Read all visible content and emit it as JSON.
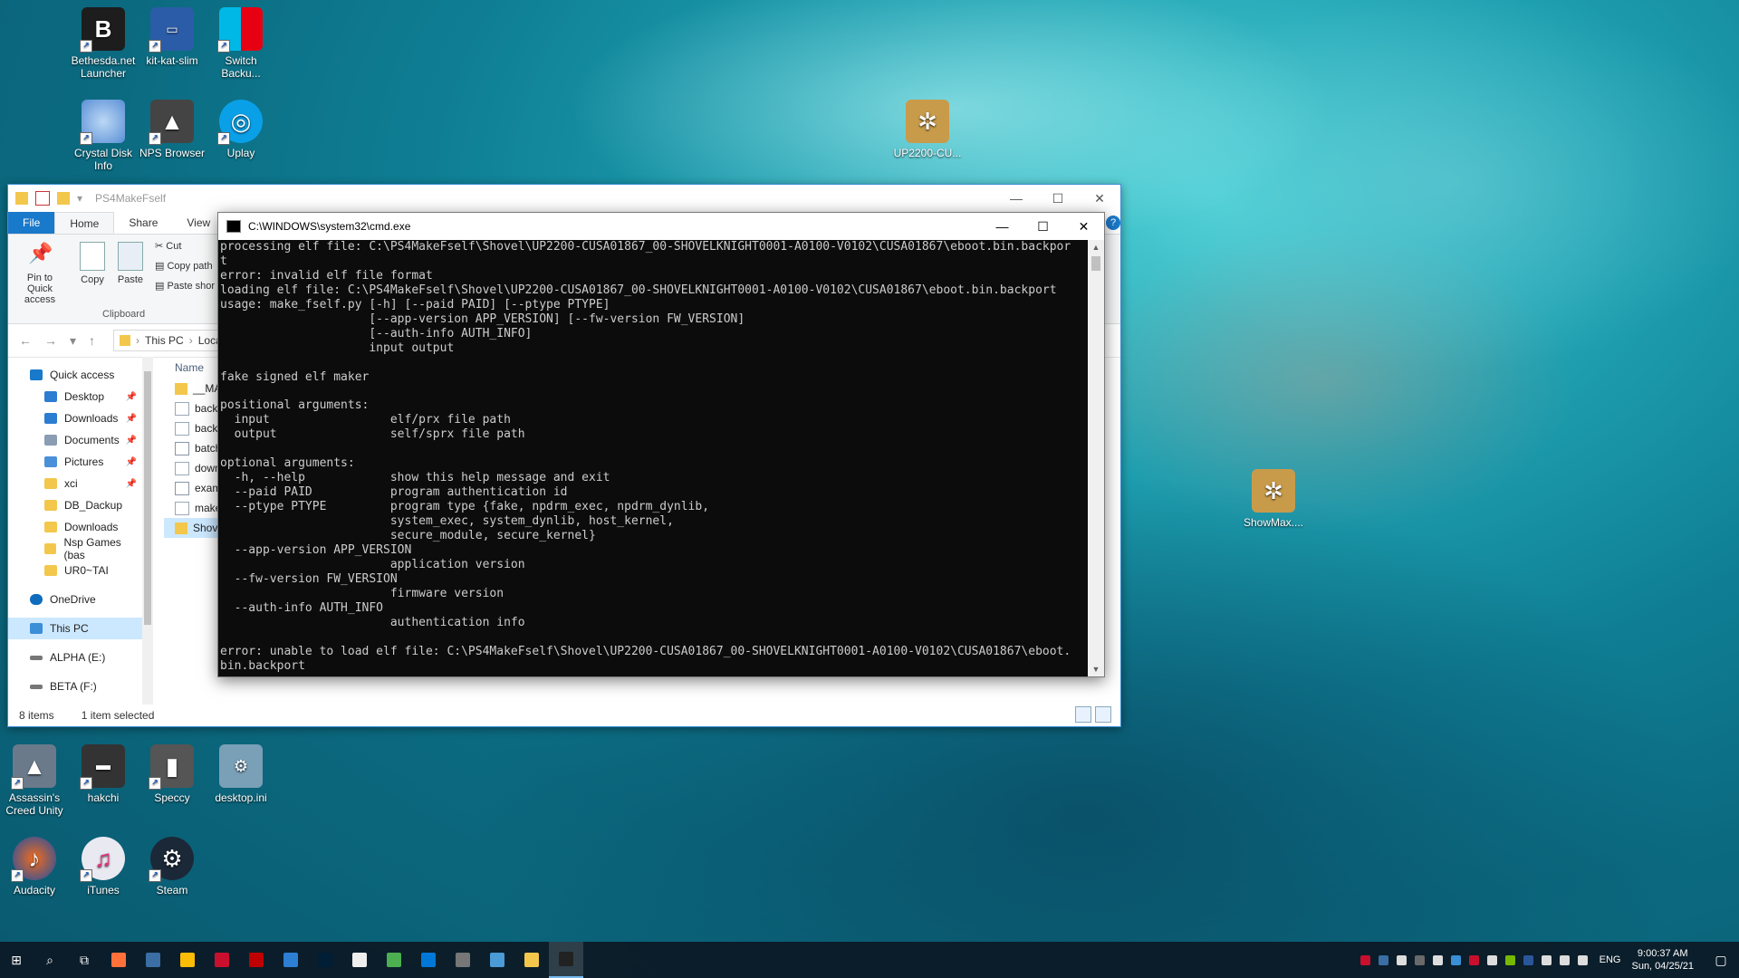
{
  "desktop": {
    "icons": [
      {
        "label": "Bethesda.net Launcher",
        "icon": "bethesda-icon",
        "color": "#1d1d1d"
      },
      {
        "label": "kit-kat-slim",
        "icon": "kit-kat-slim-icon",
        "color": "#2b5ca8"
      },
      {
        "label": "Switch Backu...",
        "icon": "switch-icon",
        "color": "#e60012"
      },
      {
        "label": "Crystal Disk Info",
        "icon": "crystal-disk-icon",
        "color": "#5a8fd6"
      },
      {
        "label": "NPS Browser",
        "icon": "nps-browser-icon",
        "color": "#444444"
      },
      {
        "label": "Uplay",
        "icon": "uplay-icon",
        "color": "#0aa0e8"
      },
      {
        "label": "UP2200-CU...",
        "icon": "package-icon",
        "color": "#c89b4a"
      },
      {
        "label": "ShowMax....",
        "icon": "package-icon",
        "color": "#c89b4a"
      },
      {
        "label": "Assassin's Creed Unity",
        "icon": "assassins-creed-icon",
        "color": "#6a7a8a"
      },
      {
        "label": "hakchi",
        "icon": "hakchi-icon",
        "color": "#333333"
      },
      {
        "label": "Speccy",
        "icon": "speccy-icon",
        "color": "#555555"
      },
      {
        "label": "desktop.ini",
        "icon": "ini-file-icon",
        "color": "#7aa0b8"
      },
      {
        "label": "Audacity",
        "icon": "audacity-icon",
        "color": "#f26b1d"
      },
      {
        "label": "iTunes",
        "icon": "itunes-icon",
        "color": "#e9e9f2"
      },
      {
        "label": "Steam",
        "icon": "steam-icon",
        "color": "#1b2838"
      }
    ]
  },
  "explorer": {
    "title": "PS4MakeFself",
    "tabs": [
      "File",
      "Home",
      "Share",
      "View"
    ],
    "ribbon": {
      "pin_label": "Pin to Quick access",
      "copy_label": "Copy",
      "paste_label": "Paste",
      "cut_label": "Cut",
      "copy_path_label": "Copy path",
      "paste_shortcut_label": "Paste shor",
      "group_label": "Clipboard"
    },
    "address": {
      "crumb1": "This PC",
      "crumb2": "Loca"
    },
    "nav_items": [
      {
        "label": "Quick access",
        "color": "#1979ca",
        "pinned": false
      },
      {
        "label": "Desktop",
        "color": "#2c7cd1",
        "pinned": true
      },
      {
        "label": "Downloads",
        "color": "#2c7cd1",
        "pinned": true
      },
      {
        "label": "Documents",
        "color": "#8a9db3",
        "pinned": true
      },
      {
        "label": "Pictures",
        "color": "#4a90d9",
        "pinned": true
      },
      {
        "label": "xci",
        "color": "#f3c74c",
        "pinned": true
      },
      {
        "label": "DB_Dackup",
        "color": "#f3c74c",
        "pinned": false
      },
      {
        "label": "Downloads",
        "color": "#f3c74c",
        "pinned": false
      },
      {
        "label": "Nsp Games (bas",
        "color": "#f3c74c",
        "pinned": false
      },
      {
        "label": "UR0~TAI",
        "color": "#f3c74c",
        "pinned": false
      },
      {
        "label": "OneDrive",
        "color": "#0f6cbd",
        "pinned": false
      },
      {
        "label": "This PC",
        "color": "#3a8fd6",
        "pinned": false
      },
      {
        "label": "ALPHA (E:)",
        "color": "#777777",
        "pinned": false
      },
      {
        "label": "BETA (F:)",
        "color": "#777777",
        "pinned": false
      }
    ],
    "files_header": "Name",
    "files": [
      {
        "label": "__MAC",
        "color": "#f3c74c"
      },
      {
        "label": "backp",
        "color": "#9aa9b8"
      },
      {
        "label": "backp",
        "color": "#9aa9b8"
      },
      {
        "label": "batch_",
        "color": "#8896a5"
      },
      {
        "label": "downg",
        "color": "#9aa9b8"
      },
      {
        "label": "examp",
        "color": "#8896a5"
      },
      {
        "label": "make_",
        "color": "#9aa9b8"
      },
      {
        "label": "Shovel",
        "color": "#f3c74c"
      }
    ],
    "status_count": "8 items",
    "status_selected": "1 item selected"
  },
  "cmd": {
    "title": "C:\\WINDOWS\\system32\\cmd.exe",
    "output": "processing elf file: C:\\PS4MakeFself\\Shovel\\UP2200-CUSA01867_00-SHOVELKNIGHT0001-A0100-V0102\\CUSA01867\\eboot.bin.backpor\nt\nerror: invalid elf file format\nloading elf file: C:\\PS4MakeFself\\Shovel\\UP2200-CUSA01867_00-SHOVELKNIGHT0001-A0100-V0102\\CUSA01867\\eboot.bin.backport\nusage: make_fself.py [-h] [--paid PAID] [--ptype PTYPE]\n                     [--app-version APP_VERSION] [--fw-version FW_VERSION]\n                     [--auth-info AUTH_INFO]\n                     input output\n\nfake signed elf maker\n\npositional arguments:\n  input                 elf/prx file path\n  output                self/sprx file path\n\noptional arguments:\n  -h, --help            show this help message and exit\n  --paid PAID           program authentication id\n  --ptype PTYPE         program type {fake, npdrm_exec, npdrm_dynlib,\n                        system_exec, system_dynlib, host_kernel,\n                        secure_module, secure_kernel}\n  --app-version APP_VERSION\n                        application version\n  --fw-version FW_VERSION\n                        firmware version\n  --auth-info AUTH_INFO\n                        authentication info\n\nerror: unable to load elf file: C:\\PS4MakeFself\\Shovel\\UP2200-CUSA01867_00-SHOVELKNIGHT0001-A0100-V0102\\CUSA01867\\eboot.\nbin.backport"
  },
  "taskbar": {
    "apps": [
      {
        "icon": "firefox-icon",
        "color": "#ff7139"
      },
      {
        "icon": "cmd-app-icon",
        "color": "#3a6ea5"
      },
      {
        "icon": "chrome-icon",
        "color": "#fbbc05"
      },
      {
        "icon": "msi-icon",
        "color": "#c8102e"
      },
      {
        "icon": "filezilla-icon",
        "color": "#bf0000"
      },
      {
        "icon": "window-app-icon",
        "color": "#2d7fd3"
      },
      {
        "icon": "photoshop-icon",
        "color": "#001e36"
      },
      {
        "icon": "xmedia-icon",
        "color": "#eeeeee"
      },
      {
        "icon": "spreadsheet-icon",
        "color": "#4caf50"
      },
      {
        "icon": "remote-desktop-icon",
        "color": "#0078d7"
      },
      {
        "icon": "calculator-icon",
        "color": "#777777"
      },
      {
        "icon": "monitor-icon",
        "color": "#4a9bd6"
      },
      {
        "icon": "file-explorer-icon",
        "color": "#f3c74c"
      },
      {
        "icon": "cmd-icon",
        "color": "#222222"
      }
    ],
    "tray": [
      {
        "icon": "mcafee-icon",
        "color": "#c8102e"
      },
      {
        "icon": "tray-app-icon",
        "color": "#3a6ea5"
      },
      {
        "icon": "mail-icon",
        "color": "#dddddd"
      },
      {
        "icon": "tray-app-icon",
        "color": "#6a6a6a"
      },
      {
        "icon": "usb-icon",
        "color": "#dddddd"
      },
      {
        "icon": "bluetooth-icon",
        "color": "#3a8fd6"
      },
      {
        "icon": "msi-tray-icon",
        "color": "#c8102e"
      },
      {
        "icon": "shield-icon",
        "color": "#dddddd"
      },
      {
        "icon": "nvidia-icon",
        "color": "#76b900"
      },
      {
        "icon": "word-icon",
        "color": "#2b579a"
      },
      {
        "icon": "battery-icon",
        "color": "#dddddd"
      },
      {
        "icon": "wifi-icon",
        "color": "#dddddd"
      },
      {
        "icon": "volume-icon",
        "color": "#dddddd"
      }
    ],
    "lang": "ENG",
    "time": "9:00:37 AM",
    "date": "Sun, 04/25/21"
  }
}
